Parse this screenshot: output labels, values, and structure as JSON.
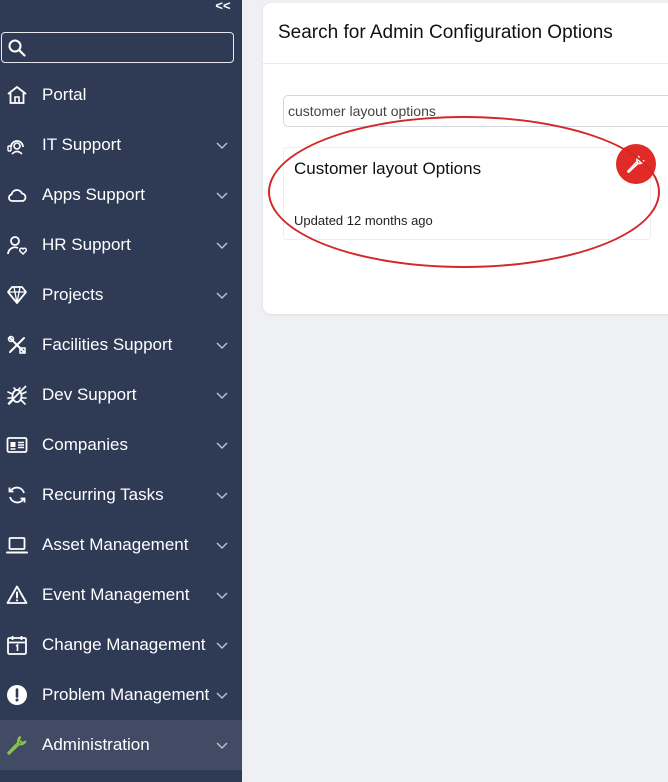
{
  "sidebar": {
    "collapse_label": "<<",
    "search": {
      "value": "",
      "placeholder": ""
    },
    "items": [
      {
        "label": "Portal",
        "icon": "home-icon",
        "expandable": false
      },
      {
        "label": "IT Support",
        "icon": "it-support-icon",
        "expandable": true
      },
      {
        "label": "Apps Support",
        "icon": "cloud-icon",
        "expandable": true
      },
      {
        "label": "HR Support",
        "icon": "user-heart-icon",
        "expandable": true
      },
      {
        "label": "Projects",
        "icon": "diamond-icon",
        "expandable": true
      },
      {
        "label": "Facilities Support",
        "icon": "tools-icon",
        "expandable": true
      },
      {
        "label": "Dev Support",
        "icon": "bug-icon",
        "expandable": true
      },
      {
        "label": "Companies",
        "icon": "id-card-icon",
        "expandable": true
      },
      {
        "label": "Recurring Tasks",
        "icon": "refresh-icon",
        "expandable": true
      },
      {
        "label": "Asset Management",
        "icon": "laptop-icon",
        "expandable": true
      },
      {
        "label": "Event Management",
        "icon": "warning-icon",
        "expandable": true
      },
      {
        "label": "Change Management",
        "icon": "calendar-icon",
        "expandable": true
      },
      {
        "label": "Problem Management",
        "icon": "alert-circle-icon",
        "expandable": true
      },
      {
        "label": "Administration",
        "icon": "wrench-icon",
        "expandable": true,
        "active": true
      }
    ]
  },
  "main": {
    "title": "Search for Admin Configuration Options",
    "search": {
      "value": "customer layout options"
    },
    "result": {
      "title": "Customer layout Options",
      "updated": "Updated 12 months ago",
      "badge_icon": "wrench-icon"
    }
  },
  "colors": {
    "sidebar_bg": "#2f3a55",
    "sidebar_active": "#414b64",
    "page_bg": "#eef0f3",
    "badge_red": "#e02b27",
    "annotation_red": "#d42727",
    "admin_icon_green": "#8bc34a"
  }
}
